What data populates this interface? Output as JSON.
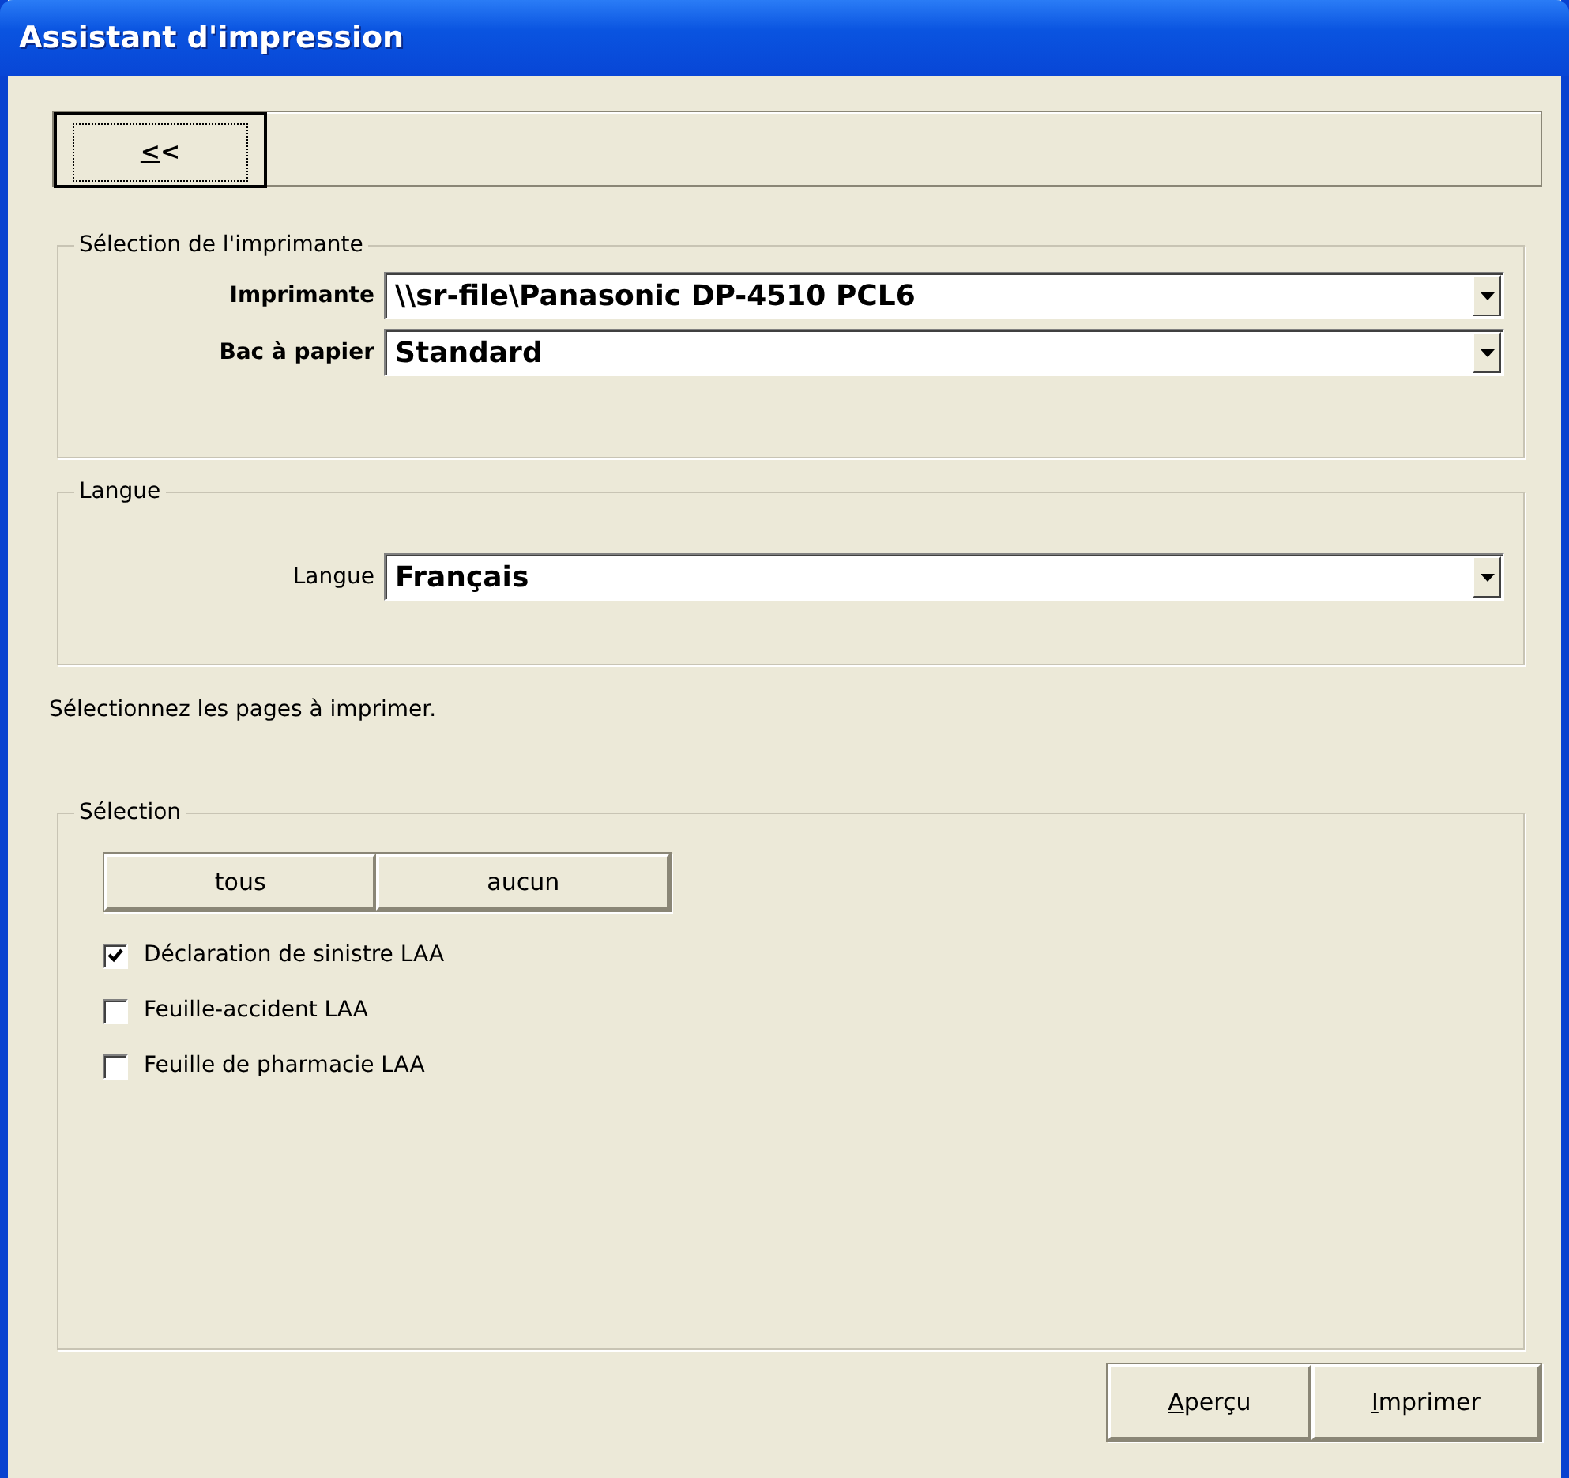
{
  "window": {
    "title": "Assistant d'impression"
  },
  "toolbar": {
    "back_button": {
      "label": "<<",
      "first_letter_underlined": true
    }
  },
  "printer_group": {
    "title": "Sélection de l'imprimante",
    "fields": [
      {
        "label": "Imprimante",
        "value": "\\\\sr-file\\Panasonic DP-4510 PCL6"
      },
      {
        "label": "Bac à papier",
        "value": "Standard"
      }
    ]
  },
  "language_group": {
    "title": "Langue",
    "fields": [
      {
        "label": "Langue",
        "value": "Français"
      }
    ]
  },
  "instruction": "Sélectionnez les pages à imprimer.",
  "selection_group": {
    "title": "Sélection",
    "buttons": [
      "tous",
      "aucun"
    ],
    "items": [
      {
        "label": "Déclaration de sinistre LAA",
        "checked": true
      },
      {
        "label": "Feuille-accident LAA",
        "checked": false
      },
      {
        "label": "Feuille de pharmacie LAA",
        "checked": false
      }
    ]
  },
  "footer_buttons": [
    {
      "label": "Aperçu",
      "first_letter_underlined": true
    },
    {
      "label": "Imprimer",
      "first_letter_underlined": true
    }
  ]
}
